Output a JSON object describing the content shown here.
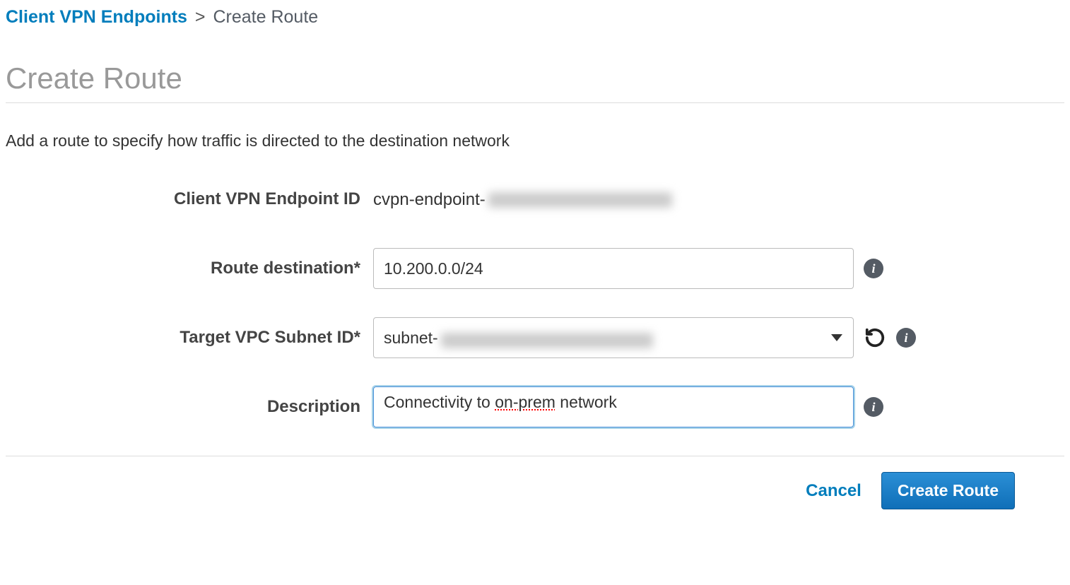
{
  "breadcrumb": {
    "parent": "Client VPN Endpoints",
    "current": "Create Route"
  },
  "page": {
    "title": "Create Route",
    "description": "Add a route to specify how traffic is directed to the destination network"
  },
  "form": {
    "endpoint_id": {
      "label": "Client VPN Endpoint ID",
      "value_prefix": "cvpn-endpoint-"
    },
    "route_destination": {
      "label": "Route destination*",
      "value": "10.200.0.0/24"
    },
    "target_subnet": {
      "label": "Target VPC Subnet ID*",
      "value_prefix": "subnet-"
    },
    "description": {
      "label": "Description",
      "value_pre": "Connectivity to ",
      "value_mid": "on-prem",
      "value_post": " network"
    }
  },
  "actions": {
    "cancel": "Cancel",
    "submit": "Create Route"
  }
}
